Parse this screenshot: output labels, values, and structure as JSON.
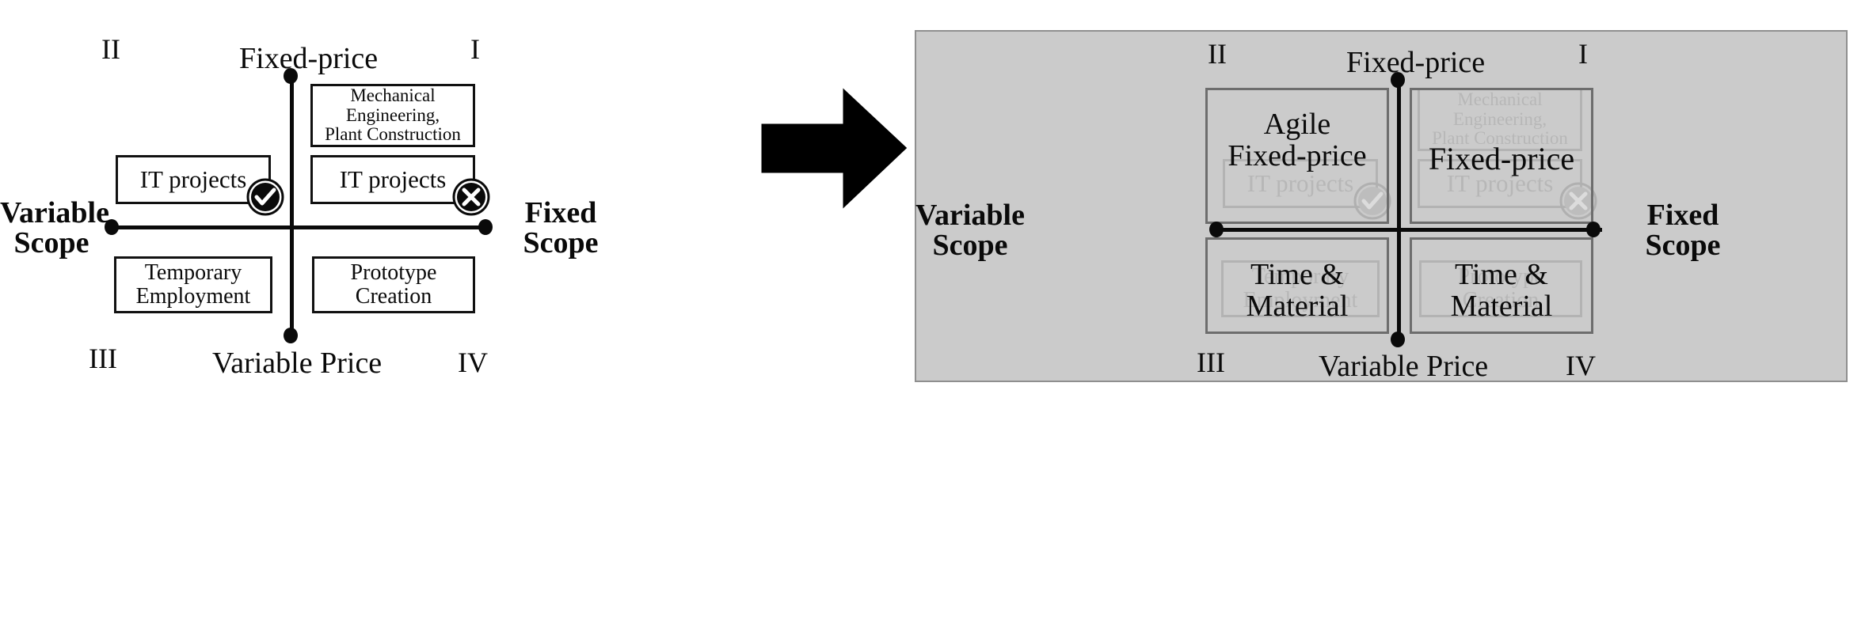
{
  "axes": {
    "top_label": "Fixed-price",
    "bottom_label": "Variable Price",
    "left_label": "Variable\nScope",
    "right_label": "Fixed\nScope"
  },
  "quadrant_numbers": {
    "one": "I",
    "two": "II",
    "three": "III",
    "four": "IV"
  },
  "left_diagram": {
    "quadrant_I": {
      "box_top": "Mechanical\nEngineering,\nPlant Construction",
      "box_bottom": "IT projects",
      "badge": "cross-icon"
    },
    "quadrant_II": {
      "box": "IT projects",
      "badge": "check-icon"
    },
    "quadrant_III": {
      "box": "Temporary\nEmployment"
    },
    "quadrant_IV": {
      "box": "Prototype\nCreation"
    }
  },
  "arrow": {
    "icon": "right-arrow-icon"
  },
  "right_panel": {
    "background_color": "#cbcbcb",
    "ghost": {
      "quadrant_I": {
        "box_top": "Mechanical\nEngineering,\nPlant Construction",
        "box_bottom": "IT projects",
        "badge": "cross-icon"
      },
      "quadrant_II": {
        "box": "IT projects",
        "badge": "check-icon"
      },
      "quadrant_III": {
        "box": "Temporary\nEmployment"
      },
      "quadrant_IV": {
        "box": "Prototype\nCreation"
      }
    },
    "results": {
      "quadrant_II": "Agile\nFixed-price",
      "quadrant_I": "Fixed-price",
      "quadrant_III": "Time &\nMaterial",
      "quadrant_IV": "Time &\nMaterial"
    }
  },
  "colors": {
    "ink": "#0a0a0a",
    "panel_fill": "#cbcbcb",
    "panel_border": "#8f8f8f",
    "ghost_ink": "#b7b7b7",
    "frame_border": "#6d6d6d"
  }
}
